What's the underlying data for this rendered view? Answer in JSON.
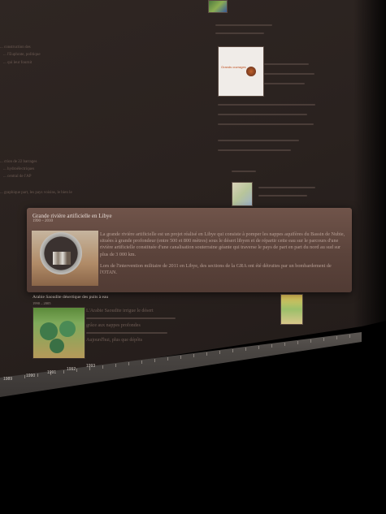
{
  "popup": {
    "title": "Grande rivière artificielle en Libye",
    "dates": "1990 – 2010",
    "paragraph1": "La grande rivière artificielle est un projet réalisé en Libye qui consiste à pomper les nappes aquifères du Bassin de Nubie, situées à grande profondeur (entre 500 et 800 mètres) sous le désert libyen et de répartir cette eau sur le parcours d'une rivière artificielle constituée d'une canalisation souterraine géante qui traverse le pays de part en part du nord au sud sur plus de 3 000 km.",
    "paragraph2": "Lors de l'intervention militaire de 2011 en Libye, des sections de la GRA ont été détruites par un bombardement de l'OTAN."
  },
  "entry_below": {
    "title": "Arabie Saoudite désertique des puits à eau",
    "dates": "1990 – 2005",
    "line1": "L'Arabie Saoudite irrigue le désert",
    "line2": "grâce aux nappes profondes",
    "line3": "Aujourd'hui, plus que dépôts"
  },
  "background_text": {
    "left1": "... construction des",
    "left2": "... l'Euphrate, politique",
    "left3": "... qui leur fournit",
    "left4": "... ction de 22 barrages",
    "left5": "... hydroélectriques",
    "left6": "... central de l'AP",
    "left7": "... graphique part, les pays voisins, le bien le",
    "right_logo_caption": "Grands ouvrages"
  },
  "axis": {
    "labels": [
      "1989",
      "1990",
      "1991",
      "1992",
      "1993"
    ]
  },
  "colors": {
    "background": "#2a221f",
    "popup": "#5b433b",
    "axis": "#4a4643"
  }
}
